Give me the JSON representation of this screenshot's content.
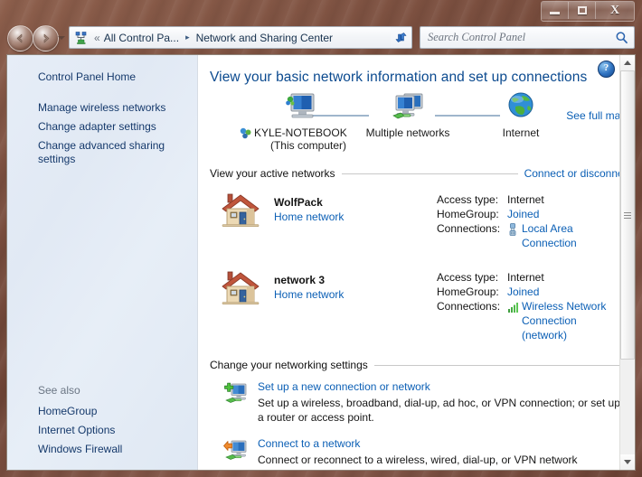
{
  "window": {
    "controls": {
      "minimize_label": "Minimize",
      "maximize_label": "Maximize",
      "close_label": "Close"
    }
  },
  "toolbar": {
    "back_label": "Back",
    "forward_label": "Forward",
    "recent_pages_label": "Recent pages",
    "breadcrumb": {
      "overflow": "«",
      "items": [
        {
          "label": "All Control Pa..."
        },
        {
          "label": "Network and Sharing Center"
        }
      ],
      "separator": "▸"
    },
    "refresh_label": "Refresh",
    "search": {
      "placeholder": "Search Control Panel",
      "value": "",
      "icon": "search-icon"
    }
  },
  "sidebar": {
    "top_items": [
      {
        "label": "Control Panel Home"
      }
    ],
    "items": [
      {
        "label": "Manage wireless networks"
      },
      {
        "label": "Change adapter settings"
      },
      {
        "label": "Change advanced sharing settings"
      }
    ],
    "see_also_label": "See also",
    "see_also_items": [
      {
        "label": "HomeGroup"
      },
      {
        "label": "Internet Options"
      },
      {
        "label": "Windows Firewall"
      }
    ]
  },
  "content": {
    "help_label": "?",
    "heading": "View your basic network information and set up connections",
    "map": {
      "see_full_map": "See full map",
      "nodes": [
        {
          "icon": "computer-icon",
          "label": "KYLE-NOTEBOOK",
          "sublabel": "(This computer)"
        },
        {
          "icon": "multiple-networks-icon",
          "label": "Multiple networks",
          "sublabel": ""
        },
        {
          "icon": "internet-globe-icon",
          "label": "Internet",
          "sublabel": ""
        }
      ]
    },
    "active_networks": {
      "heading": "View your active networks",
      "action": "Connect or disconnect",
      "rows": [
        {
          "icon": "home-network-icon",
          "name": "WolfPack",
          "type": "Home network",
          "details": [
            {
              "label": "Access type:",
              "value": "Internet",
              "link": false
            },
            {
              "label": "HomeGroup:",
              "value": "Joined",
              "link": true
            }
          ],
          "connections_label": "Connections:",
          "connection_icon": "ethernet-icon",
          "connection_text": "Local Area Connection"
        },
        {
          "icon": "home-network-icon",
          "name": "network  3",
          "type": "Home network",
          "details": [
            {
              "label": "Access type:",
              "value": "Internet",
              "link": false
            },
            {
              "label": "HomeGroup:",
              "value": "Joined",
              "link": true
            }
          ],
          "connections_label": "Connections:",
          "connection_icon": "wireless-signal-icon",
          "connection_text": "Wireless Network Connection (network)"
        }
      ]
    },
    "networking_settings": {
      "heading": "Change your networking settings",
      "items": [
        {
          "icon": "new-connection-icon",
          "title": "Set up a new connection or network",
          "description": "Set up a wireless, broadband, dial-up, ad hoc, or VPN connection; or set up a router or access point."
        },
        {
          "icon": "connect-network-icon",
          "title": "Connect to a network",
          "description": "Connect or reconnect to a wireless, wired, dial-up, or VPN network"
        }
      ]
    }
  },
  "scrollbar": {
    "up_label": "Scroll up",
    "down_label": "Scroll down",
    "thumb_label": "Scroll thumb"
  },
  "colors": {
    "link": "#0b5fb5",
    "heading": "#0b4a8f",
    "sidebar_bg": "#e2eaf5",
    "frame": "#7b4f3f"
  }
}
